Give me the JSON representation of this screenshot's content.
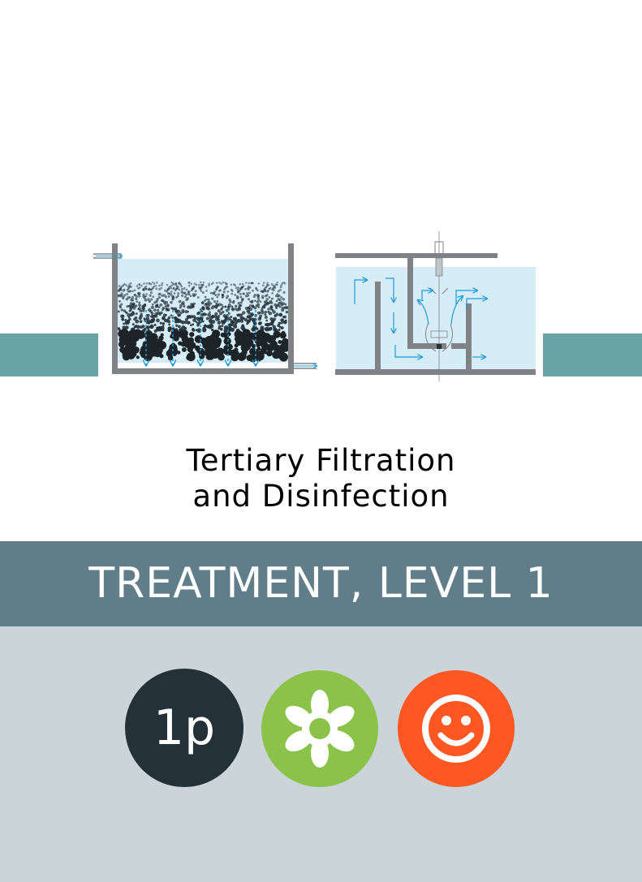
{
  "colors": {
    "teal": "#6aa3a6",
    "band": "#627d8a",
    "bottom": "#cad4d9",
    "water": "#d6ecf7",
    "wall": "#808285",
    "arrow": "#1a9cd8",
    "badge_dark": "#243138",
    "badge_green": "#8bc34a",
    "badge_orange": "#ff5722"
  },
  "title": {
    "line1": "Tertiary Filtration",
    "line2": "and Disinfection"
  },
  "band": {
    "label": "TREATMENT, LEVEL 1"
  },
  "badges": [
    {
      "icon": "text",
      "text": "1p"
    },
    {
      "icon": "flower-icon"
    },
    {
      "icon": "smiley-icon"
    }
  ]
}
